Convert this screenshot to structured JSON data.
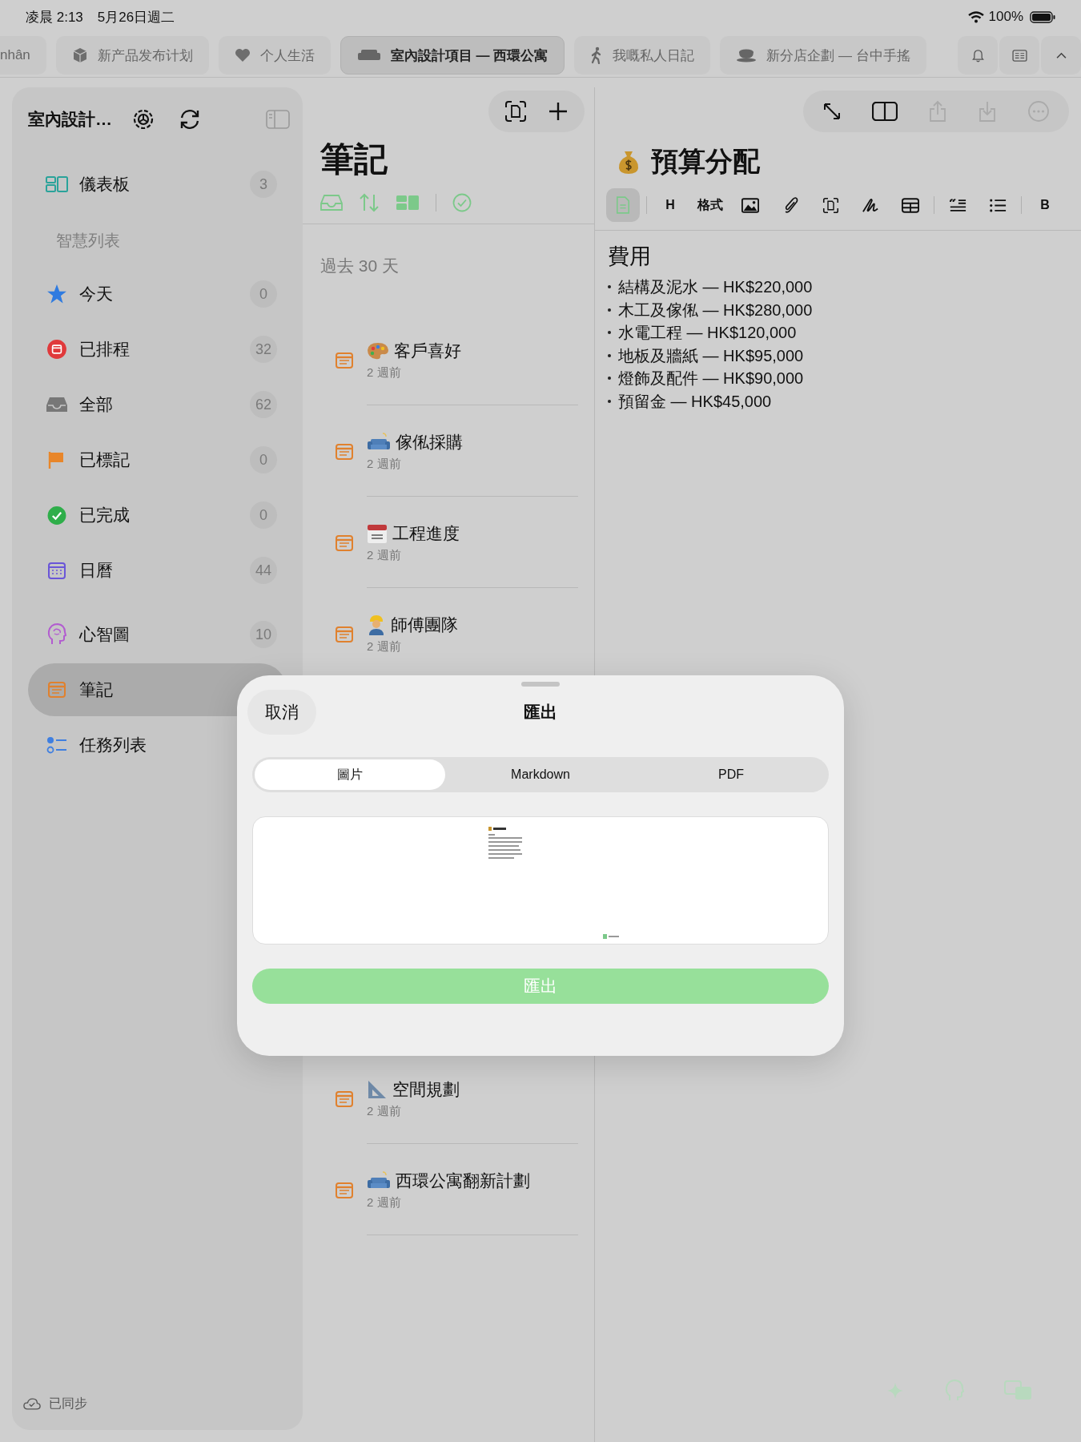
{
  "status_bar": {
    "time": "凌晨 2:13",
    "date": "5月26日週二",
    "battery": "100%"
  },
  "tabs": [
    {
      "label": "nhân",
      "kind": "plain",
      "selected": false
    },
    {
      "label": "新产品发布计划",
      "kind": "box",
      "selected": false
    },
    {
      "label": "个人生活",
      "kind": "heart",
      "selected": false
    },
    {
      "label": "室內設計項目 — 西環公寓",
      "kind": "sofa",
      "selected": true
    },
    {
      "label": "我嘅私人日記",
      "kind": "walker",
      "selected": false
    },
    {
      "label": "新分店企劃 — 台中手搖",
      "kind": "cup",
      "selected": false
    }
  ],
  "sidebar": {
    "title": "室內設計…",
    "dashboard": {
      "label": "儀表板",
      "count": "3",
      "selected": false
    },
    "section": "智慧列表",
    "smart_lists": [
      {
        "label": "今天",
        "count": "0",
        "kind": "star",
        "selected": false
      },
      {
        "label": "已排程",
        "count": "32",
        "kind": "scheduled",
        "selected": false
      },
      {
        "label": "全部",
        "count": "62",
        "kind": "tray",
        "selected": false
      },
      {
        "label": "已標記",
        "count": "0",
        "kind": "flag",
        "selected": false
      },
      {
        "label": "已完成",
        "count": "0",
        "kind": "done",
        "selected": false
      },
      {
        "label": "日曆",
        "count": "44",
        "kind": "calendar",
        "selected": false
      }
    ],
    "lists": [
      {
        "label": "心智圖",
        "count": "10",
        "kind": "brain",
        "selected": false
      },
      {
        "label": "筆記",
        "kind": "note",
        "selected": true
      },
      {
        "label": "任務列表",
        "kind": "tasks",
        "selected": false
      }
    ],
    "sync": "已同步"
  },
  "notes": {
    "title": "筆記",
    "section": "過去 30 天",
    "items_top": [
      {
        "title": "客戶喜好",
        "time": "2 週前",
        "kind": "palette"
      },
      {
        "title": "傢俬採購",
        "time": "2 週前",
        "kind": "sofa"
      },
      {
        "title": "工程進度",
        "time": "2 週前",
        "kind": "calendar"
      },
      {
        "title": "師傅團隊",
        "time": "2 週前",
        "kind": "worker"
      }
    ],
    "items_bottom": [
      {
        "title": "空間規劃",
        "time": "2 週前",
        "kind": "ruler"
      },
      {
        "title": "西環公寓翻新計劃",
        "time": "2 週前",
        "kind": "sofa"
      }
    ]
  },
  "editor": {
    "title": "預算分配",
    "toolbar": [
      {
        "kind": "doc",
        "selected": true
      },
      {
        "kind": "heading",
        "label": "H",
        "selected": false
      },
      {
        "kind": "format",
        "label": "格式",
        "selected": false
      },
      {
        "kind": "image",
        "selected": false
      },
      {
        "kind": "clip",
        "selected": false
      },
      {
        "kind": "scan",
        "selected": false
      },
      {
        "kind": "scribble",
        "selected": false
      },
      {
        "kind": "table",
        "selected": false
      },
      {
        "kind": "quote",
        "selected": false
      },
      {
        "kind": "list",
        "selected": false
      },
      {
        "kind": "bold",
        "label": "B",
        "selected": false
      }
    ],
    "heading": "費用",
    "bullets": [
      "結構及泥水 — HK$220,000",
      "木工及傢俬 — HK$280,000",
      "水電工程 — HK$120,000",
      "地板及牆紙 — HK$95,000",
      "燈飾及配件 — HK$90,000",
      "預留金 — HK$45,000"
    ]
  },
  "export_dialog": {
    "cancel": "取消",
    "title": "匯出",
    "formats": [
      {
        "label": "圖片",
        "selected": true
      },
      {
        "label": "Markdown",
        "selected": false
      },
      {
        "label": "PDF",
        "selected": false
      }
    ],
    "button": "匯出"
  }
}
